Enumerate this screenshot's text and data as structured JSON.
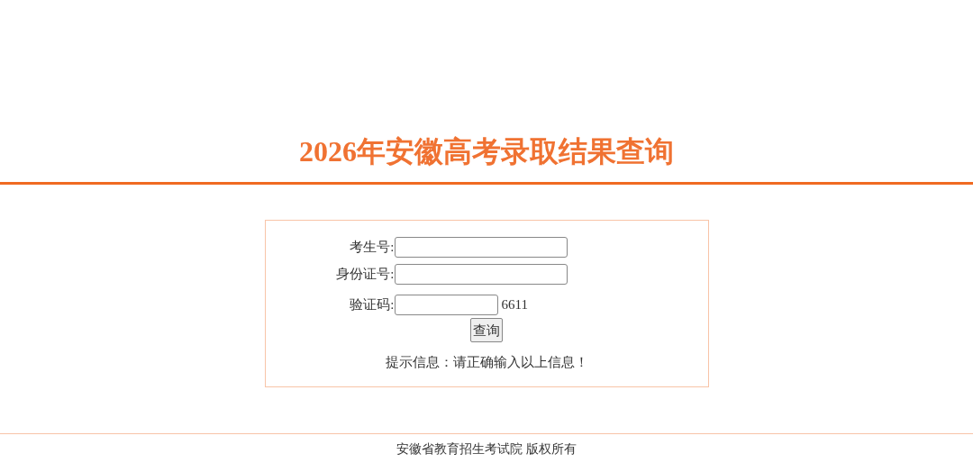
{
  "title": "2026年安徽高考录取结果查询",
  "fields": [
    {
      "kind": "text",
      "label": "考生号:"
    },
    {
      "kind": "text",
      "label": "身份证号:"
    },
    {
      "kind": "captcha",
      "label": "验证码:",
      "code": "6611"
    }
  ],
  "submit": "查询",
  "hint": "提示信息：请正确输入以上信息！",
  "footer": "安徽省教育招生考试院 版权所有"
}
